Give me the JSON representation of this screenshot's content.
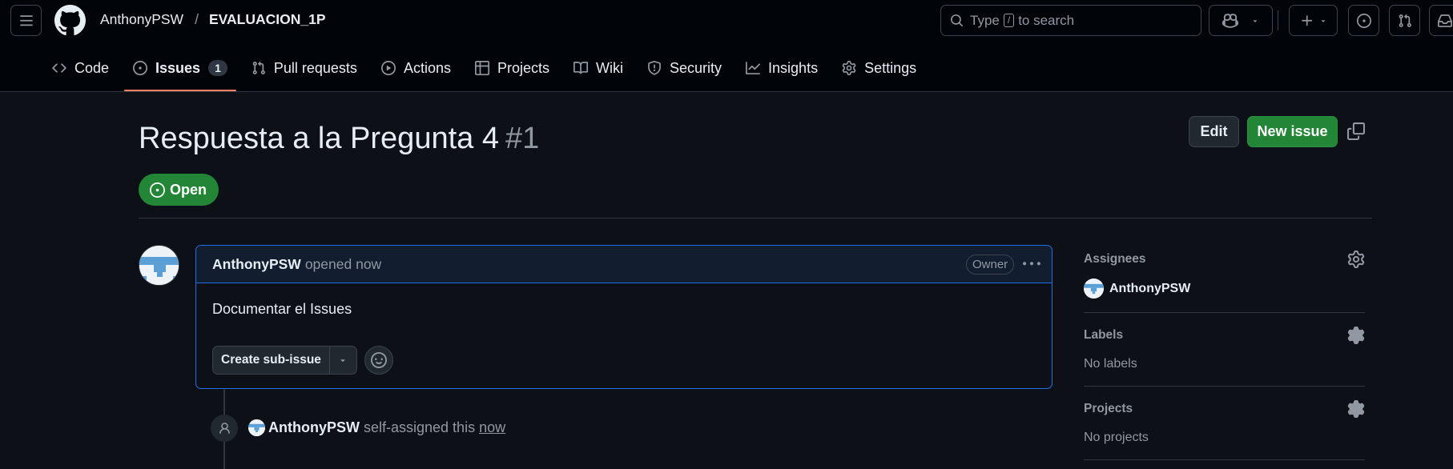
{
  "header": {
    "owner": "AnthonyPSW",
    "separator": "/",
    "repo": "EVALUACION_1P",
    "search_prefix": "Type",
    "search_key": "/",
    "search_suffix": "to search"
  },
  "tabs": [
    {
      "label": "Code",
      "icon": "code-icon"
    },
    {
      "label": "Issues",
      "icon": "issue-opened-icon",
      "count": "1",
      "active": true
    },
    {
      "label": "Pull requests",
      "icon": "git-pull-request-icon"
    },
    {
      "label": "Actions",
      "icon": "play-icon"
    },
    {
      "label": "Projects",
      "icon": "table-icon"
    },
    {
      "label": "Wiki",
      "icon": "book-icon"
    },
    {
      "label": "Security",
      "icon": "shield-icon"
    },
    {
      "label": "Insights",
      "icon": "graph-icon"
    },
    {
      "label": "Settings",
      "icon": "gear-icon"
    }
  ],
  "issue": {
    "title": "Respuesta a la Pregunta 4",
    "number": "#1",
    "state": "Open",
    "edit_label": "Edit",
    "new_issue_label": "New issue"
  },
  "comment": {
    "author": "AnthonyPSW",
    "meta": "opened now",
    "role_badge": "Owner",
    "body": "Documentar el Issues",
    "sub_issue_label": "Create sub-issue"
  },
  "timeline": {
    "author": "AnthonyPSW",
    "action": "self-assigned this",
    "when": "now"
  },
  "sidebar": {
    "assignees": {
      "heading": "Assignees",
      "user": "AnthonyPSW"
    },
    "labels": {
      "heading": "Labels",
      "value": "No labels"
    },
    "projects": {
      "heading": "Projects",
      "value": "No projects"
    }
  },
  "colors": {
    "background": "#0d1117",
    "header": "#010409",
    "accent_green": "#238636",
    "tab_underline": "#f78166",
    "comment_border": "#1f6feb"
  }
}
